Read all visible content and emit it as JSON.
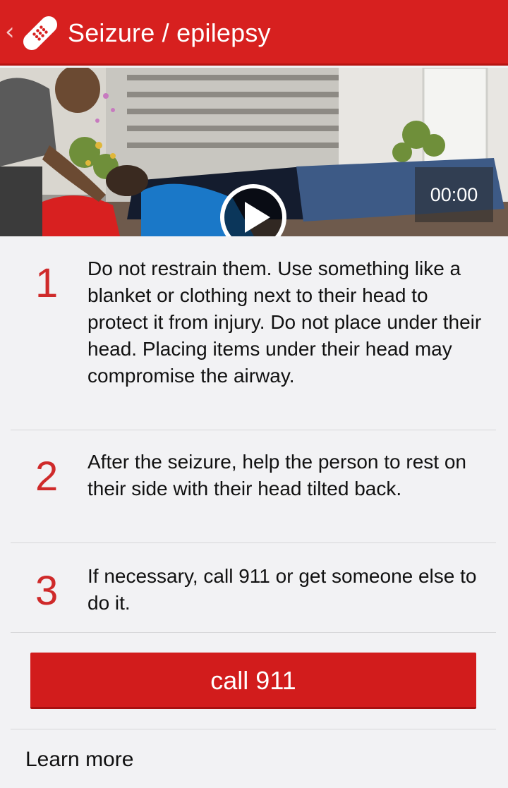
{
  "header": {
    "back_icon": "chevron-left-icon",
    "app_icon": "bandage-icon",
    "title": "Seizure / epilepsy",
    "color": "#d7201f"
  },
  "video": {
    "play_icon": "play-icon",
    "timestamp": "00:00"
  },
  "steps": [
    {
      "number": "1",
      "text": "Do not restrain them. Use something like a blanket or clothing next to their head to protect it from injury. Do not place under their head. Placing items under their head may compromise the airway."
    },
    {
      "number": "2",
      "text": "After the seizure, help the person to rest on their side with their head tilted back."
    },
    {
      "number": "3",
      "text": "If necessary, call 911 or get someone else to do it."
    }
  ],
  "call_button": {
    "label": "call 911",
    "color": "#d21c1c"
  },
  "learn_more": {
    "label": "Learn more"
  }
}
